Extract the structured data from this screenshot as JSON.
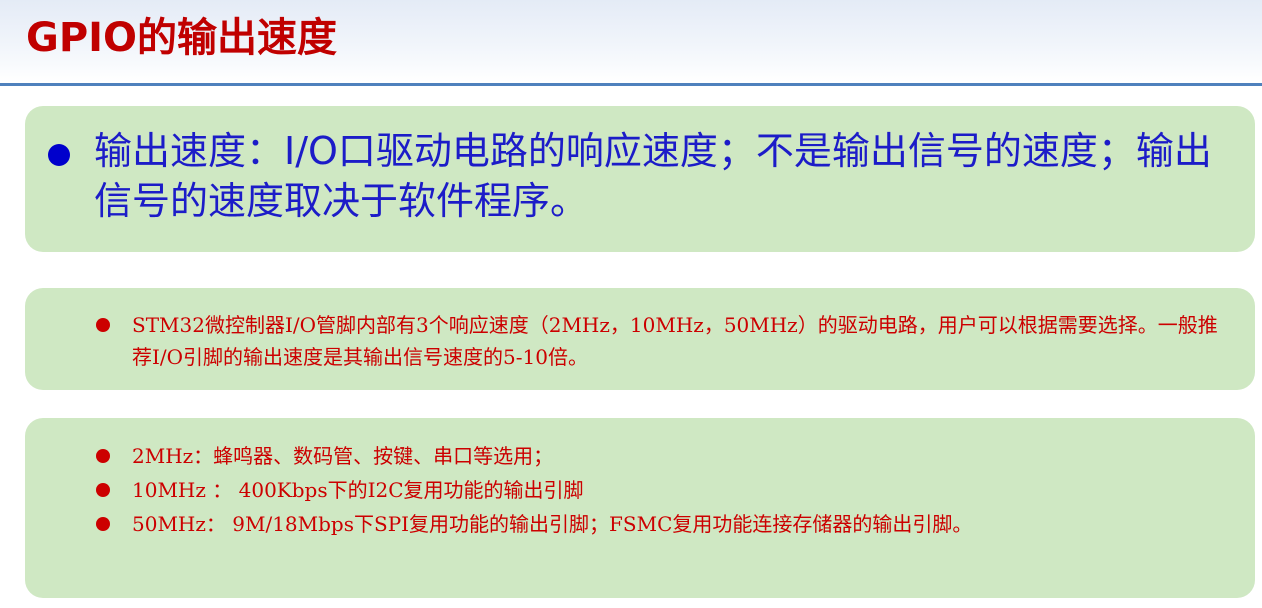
{
  "header": {
    "title": "GPIO的输出速度"
  },
  "main_bullet": {
    "text": "输出速度：I/O口驱动电路的响应速度；不是输出信号的速度；输出信号的速度取决于软件程序。"
  },
  "detail_bullet": {
    "text": "STM32微控制器I/O管脚内部有3个响应速度（2MHz，10MHz，50MHz）的驱动电路，用户可以根据需要选择。一般推荐I/O引脚的输出速度是其输出信号速度的5-10倍。"
  },
  "speed_list": [
    {
      "text": "2MHz：蜂鸣器、数码管、按键、串口等选用；"
    },
    {
      "text": "10MHz ： 400Kbps下的I2C复用功能的输出引脚"
    },
    {
      "text": "50MHz： 9M/18Mbps下SPI复用功能的输出引脚；FSMC复用功能连接存储器的输出引脚。"
    }
  ],
  "colors": {
    "title": "#c00000",
    "main_text": "#1c1cc8",
    "detail_text": "#cc0000",
    "panel_bg": "#cfe8c3",
    "header_rule": "#4f81bd"
  }
}
